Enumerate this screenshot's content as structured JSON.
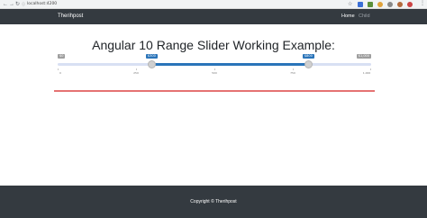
{
  "browser": {
    "address": "localhost:4200"
  },
  "navbar": {
    "brand": "Therihpost",
    "links": [
      {
        "label": "Home",
        "active": true
      },
      {
        "label": "Child",
        "active": false
      }
    ]
  },
  "page": {
    "title": "Angular 10 Range Slider Working Example:"
  },
  "slider": {
    "floor": "$0",
    "ceil": "$1,000",
    "low": "$300",
    "high": "$800",
    "floor_value": 0,
    "ceil_value": 1000,
    "low_value": 300,
    "high_value": 800,
    "ticks": [
      "0",
      "250",
      "500",
      "750",
      "1,000"
    ]
  },
  "footer": {
    "copyright": "Copyright © Therihpost"
  },
  "colors": {
    "navbar_bg": "#343a40",
    "slider_selection": "#2a74b9",
    "red_rule": "#e57373"
  }
}
